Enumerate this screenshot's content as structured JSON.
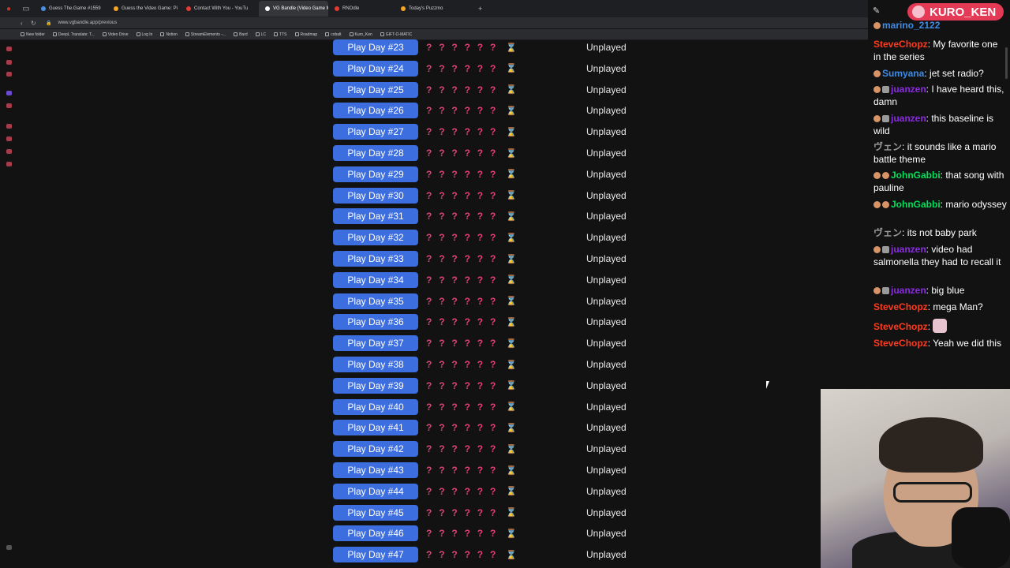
{
  "browser": {
    "tabs": [
      {
        "title": "Guess The.Game #1559",
        "color": "#4a90e2"
      },
      {
        "title": "Guess the Video Game: Pi",
        "color": "#f5a623"
      },
      {
        "title": "Contact With You - YouTu",
        "color": "#e53935"
      },
      {
        "title": "VG Bandle (Video Game M",
        "color": "#ffffff",
        "active": true
      },
      {
        "title": "RNOdle",
        "color": "#e53935"
      },
      {
        "title": "Today's Puzzmo",
        "color": "#f5a623"
      }
    ],
    "new_tab": "+",
    "url": "www.vgbandle.app/previous",
    "bookmarks": [
      "New folder",
      "DeepL Translate: T...",
      "Video Drive",
      "Log In",
      "Notion",
      "StreamElements -...",
      "Bard",
      "LC",
      "TTS",
      "Roadmap",
      "cobalt",
      "Kuro_Ken",
      "GIFT-O-MATIC"
    ]
  },
  "puzzle_list": {
    "hidden_mark": "?",
    "hint_icon": "⌛",
    "rows": [
      {
        "label": "Play Day #23",
        "status": "Unplayed"
      },
      {
        "label": "Play Day #24",
        "status": "Unplayed"
      },
      {
        "label": "Play Day #25",
        "status": "Unplayed"
      },
      {
        "label": "Play Day #26",
        "status": "Unplayed"
      },
      {
        "label": "Play Day #27",
        "status": "Unplayed"
      },
      {
        "label": "Play Day #28",
        "status": "Unplayed"
      },
      {
        "label": "Play Day #29",
        "status": "Unplayed"
      },
      {
        "label": "Play Day #30",
        "status": "Unplayed"
      },
      {
        "label": "Play Day #31",
        "status": "Unplayed"
      },
      {
        "label": "Play Day #32",
        "status": "Unplayed"
      },
      {
        "label": "Play Day #33",
        "status": "Unplayed"
      },
      {
        "label": "Play Day #34",
        "status": "Unplayed"
      },
      {
        "label": "Play Day #35",
        "status": "Unplayed"
      },
      {
        "label": "Play Day #36",
        "status": "Unplayed"
      },
      {
        "label": "Play Day #37",
        "status": "Unplayed"
      },
      {
        "label": "Play Day #38",
        "status": "Unplayed"
      },
      {
        "label": "Play Day #39",
        "status": "Unplayed"
      },
      {
        "label": "Play Day #40",
        "status": "Unplayed"
      },
      {
        "label": "Play Day #41",
        "status": "Unplayed"
      },
      {
        "label": "Play Day #42",
        "status": "Unplayed"
      },
      {
        "label": "Play Day #43",
        "status": "Unplayed"
      },
      {
        "label": "Play Day #44",
        "status": "Unplayed"
      },
      {
        "label": "Play Day #45",
        "status": "Unplayed"
      },
      {
        "label": "Play Day #46",
        "status": "Unplayed"
      },
      {
        "label": "Play Day #47",
        "status": "Unplayed"
      }
    ]
  },
  "stream_overlay": {
    "channel_logo": "KURO_KEN",
    "chat": [
      {
        "user": "marino_2122",
        "text": "",
        "color": "#3c8ce8"
      },
      {
        "user": "SteveChopz",
        "text": "My favorite one in the series",
        "color": "#ff3b1f"
      },
      {
        "user": "Sumyana",
        "text": "jet set radio?",
        "color": "#3c8ce8"
      },
      {
        "user": "juanzen",
        "text": "I have heard this, damn",
        "color": "#8a2be2"
      },
      {
        "user": "juanzen",
        "text": "this baseline is wild",
        "color": "#8a2be2"
      },
      {
        "user": "ヴェン",
        "text": "it sounds like a mario battle theme",
        "color": "#9a9a9a"
      },
      {
        "user": "JohnGabbi",
        "text": "that song with pauline",
        "color": "#00e05a"
      },
      {
        "user": "JohnGabbi",
        "text": "mario odyssey",
        "color": "#00e05a"
      },
      {
        "user": "ヴェン",
        "text": "its not baby park",
        "color": "#9a9a9a"
      },
      {
        "user": "juanzen",
        "text": "video had salmonella they had to recall it",
        "color": "#8a2be2"
      },
      {
        "user": "juanzen",
        "text": "big blue",
        "color": "#8a2be2"
      },
      {
        "user": "SteveChopz",
        "text": "mega Man?",
        "color": "#ff3b1f"
      },
      {
        "user": "SteveChopz",
        "text": "",
        "color": "#ff3b1f"
      },
      {
        "user": "SteveChopz",
        "text": "Yeah we did this",
        "color": "#ff3b1f"
      }
    ]
  }
}
